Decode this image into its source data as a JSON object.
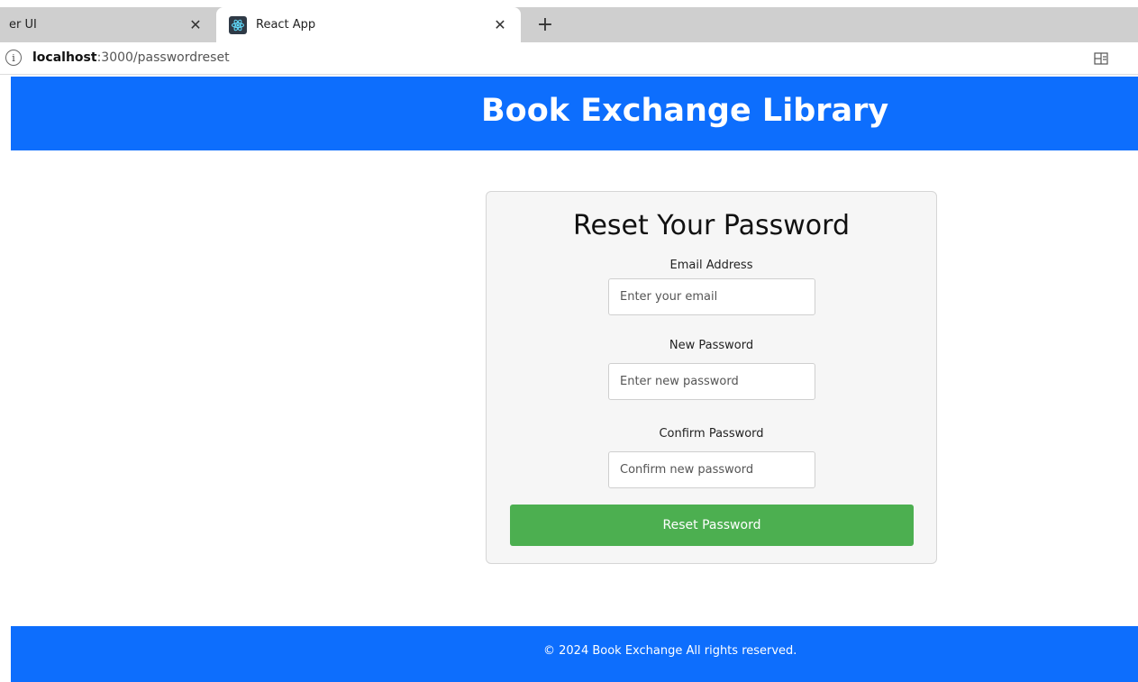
{
  "browser": {
    "tabs": [
      {
        "label": "er UI"
      },
      {
        "label": "React App"
      }
    ],
    "close_glyph": "✕",
    "new_tab_glyph": "+",
    "url_host": "localhost",
    "url_path": ":3000/passwordreset",
    "icons": [
      "info-icon",
      "react-favicon-icon",
      "reader-mode-icon"
    ]
  },
  "header": {
    "title": "Book Exchange Library"
  },
  "form": {
    "title": "Reset Your Password",
    "email": {
      "label": "Email Address",
      "placeholder": "Enter your email",
      "value": ""
    },
    "new_password": {
      "label": "New Password",
      "placeholder": "Enter new password",
      "value": ""
    },
    "confirm_password": {
      "label": "Confirm Password",
      "placeholder": "Confirm new password",
      "value": ""
    },
    "submit_label": "Reset Password"
  },
  "footer": {
    "text": "© 2024 Book Exchange All rights reserved."
  },
  "colors": {
    "primary": "#0d6efd",
    "button": "#4caf50",
    "card_bg": "#f6f6f6"
  }
}
